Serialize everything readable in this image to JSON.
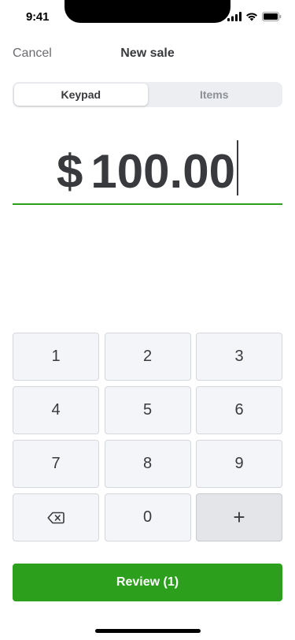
{
  "status_bar": {
    "time": "9:41",
    "icons": [
      "cellular-signal-icon",
      "wifi-icon",
      "battery-icon"
    ]
  },
  "nav": {
    "cancel_label": "Cancel",
    "title": "New sale"
  },
  "tabs": [
    {
      "label": "Keypad",
      "selected": true
    },
    {
      "label": "Items",
      "selected": false
    }
  ],
  "amount": {
    "currency_symbol": "$",
    "value": "100.00"
  },
  "keypad": {
    "keys": [
      "1",
      "2",
      "3",
      "4",
      "5",
      "6",
      "7",
      "8",
      "9",
      "0",
      "+"
    ],
    "backspace_icon": "backspace-icon"
  },
  "review_button": {
    "label": "Review (1)"
  },
  "colors": {
    "accent_green": "#2ca01c",
    "text_primary": "#393a3d",
    "text_secondary": "#6b6c72",
    "key_background": "#f4f5f8",
    "key_border": "#d4d7dc",
    "segment_background": "#eceef1"
  }
}
